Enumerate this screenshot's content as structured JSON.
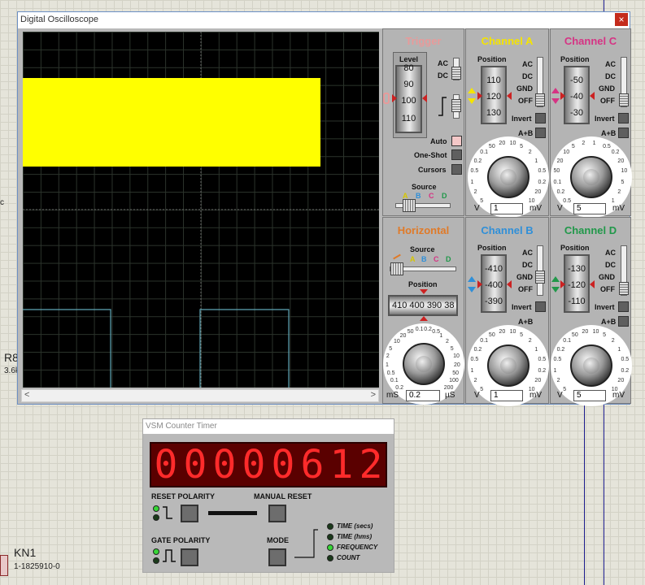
{
  "background": {
    "left_symbol": "c",
    "resistor_ref": "R8",
    "resistor_value": "3.6k",
    "part_ref": "KN1",
    "part_value": "1-1825910-0"
  },
  "oscilloscope": {
    "title": "Digital Oscilloscope",
    "close": "×",
    "scroll_left": "<",
    "scroll_right": ">",
    "trigger": {
      "title": "Trigger",
      "level_label": "Level",
      "drum": [
        "80",
        "90",
        "100",
        "110"
      ],
      "ac": "AC",
      "dc": "DC",
      "auto": "Auto",
      "oneshot": "One-Shot",
      "cursors": "Cursors",
      "source_label": "Source",
      "source_letters": [
        "A",
        "B",
        "C",
        "D"
      ]
    },
    "channel_a": {
      "title": "Channel A",
      "position_label": "Position",
      "drum": [
        "110",
        "120",
        "130"
      ],
      "ac": "AC",
      "dc": "DC",
      "gnd": "GND",
      "off": "OFF",
      "invert": "Invert",
      "aplusb": "A+B",
      "dial": [
        "5",
        "2",
        "1",
        "0.5",
        "0.2",
        "0.1",
        "50",
        "20",
        "10",
        "5",
        "2",
        "1",
        "0.5",
        "0.2",
        "20",
        "10"
      ],
      "unit_left": "V",
      "unit_right": "mV",
      "value": "1"
    },
    "channel_c": {
      "title": "Channel C",
      "position_label": "Position",
      "drum": [
        "-50",
        "-40",
        "-30"
      ],
      "ac": "AC",
      "dc": "DC",
      "gnd": "GND",
      "off": "OFF",
      "invert": "Invert",
      "aplusb": "A+B",
      "dial": [
        "0.5",
        "0.2",
        "0.1",
        "50",
        "20",
        "10",
        "5",
        "2",
        "1",
        "0.5",
        "0.2",
        "20",
        "10",
        "5",
        "2",
        "1"
      ],
      "unit_left": "V",
      "unit_right": "mV",
      "value": "5"
    },
    "horizontal": {
      "title": "Horizontal",
      "source_label": "Source",
      "source_letters": [
        "A",
        "B",
        "C",
        "D"
      ],
      "position_label": "Position",
      "tape": "410 400 390 38",
      "dial": [
        "0.2",
        "0.1",
        "0.5",
        "1",
        "2",
        "5",
        "10",
        "20",
        "50",
        "0.1",
        "0.2",
        "0.5",
        "1",
        "2",
        "5",
        "10",
        "20",
        "50",
        "100",
        "200"
      ],
      "unit_left": "mS",
      "unit_right": "µS",
      "value": "0.2"
    },
    "channel_b": {
      "title": "Channel B",
      "position_label": "Position",
      "drum": [
        "-410",
        "-400",
        "-390"
      ],
      "ac": "AC",
      "dc": "DC",
      "gnd": "GND",
      "off": "OFF",
      "invert": "Invert",
      "aplusb": "A+B",
      "dial": [
        "5",
        "2",
        "1",
        "0.5",
        "0.2",
        "0.1",
        "50",
        "20",
        "10",
        "5",
        "2",
        "1",
        "0.5",
        "0.2",
        "20",
        "10"
      ],
      "unit_left": "V",
      "unit_right": "mV",
      "value": "1"
    },
    "channel_d": {
      "title": "Channel D",
      "position_label": "Position",
      "drum": [
        "-130",
        "-120",
        "-110"
      ],
      "ac": "AC",
      "dc": "DC",
      "gnd": "GND",
      "off": "OFF",
      "invert": "Invert",
      "aplusb": "A+B",
      "dial": [
        "5",
        "2",
        "1",
        "0.5",
        "0.2",
        "0.1",
        "50",
        "20",
        "10",
        "5",
        "2",
        "1",
        "0.5",
        "0.2",
        "20",
        "10"
      ],
      "unit_left": "V",
      "unit_right": "mV",
      "value": "5"
    },
    "colors": {
      "trigger": "#e89a9a",
      "channel_a": "#f5e400",
      "channel_b": "#2f8fd8",
      "channel_c": "#d63384",
      "channel_d": "#21984a",
      "horizontal": "#e07a28",
      "trace_yellow": "#ffff00",
      "trace_cyan": "#5fa6b6"
    }
  },
  "counter": {
    "title": "VSM Counter Timer",
    "digits": [
      "0",
      "0",
      "0",
      "0",
      "0",
      "6",
      "1",
      "2"
    ],
    "reset_polarity": "RESET POLARITY",
    "manual_reset": "MANUAL RESET",
    "gate_polarity": "GATE POLARITY",
    "mode": "MODE",
    "modes": [
      "TIME (secs)",
      "TIME (hms)",
      "FREQUENCY",
      "COUNT"
    ],
    "active_mode_index": 2
  }
}
